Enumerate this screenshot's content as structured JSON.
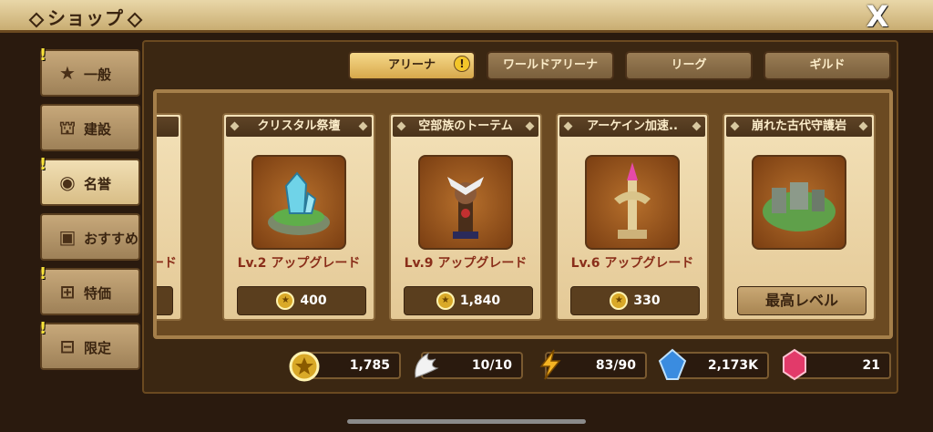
{
  "header": {
    "title": "ショップ",
    "close_label": "X"
  },
  "sidebar": {
    "items": [
      {
        "label": "一般",
        "icon": "star-icon",
        "alert": true
      },
      {
        "label": "建設",
        "icon": "building-icon",
        "alert": false
      },
      {
        "label": "名誉",
        "icon": "medal-icon",
        "alert": true,
        "active": true
      },
      {
        "label": "おすすめ",
        "icon": "gift-box-icon",
        "alert": false
      },
      {
        "label": "特価",
        "icon": "present-icon",
        "alert": true
      },
      {
        "label": "限定",
        "icon": "chest-icon",
        "alert": true
      }
    ],
    "alert_mark": "!"
  },
  "tabs": [
    {
      "label": "アリーナ",
      "active": true,
      "badge": "!"
    },
    {
      "label": "ワールドアリーナ",
      "active": false
    },
    {
      "label": "リーグ",
      "active": false
    },
    {
      "label": "ギルド",
      "active": false
    }
  ],
  "cards": [
    {
      "name": "",
      "upgrade": "レード",
      "price": "",
      "partial": true
    },
    {
      "name": "クリスタル祭壇",
      "upgrade": "Lv.2 アップグレード",
      "price": "400",
      "icon": "crystal-altar-icon"
    },
    {
      "name": "空部族のトーテム",
      "upgrade": "Lv.9 アップグレード",
      "price": "1,840",
      "icon": "totem-icon"
    },
    {
      "name": "アーケイン加速..",
      "upgrade": "Lv.6 アップグレード",
      "price": "330",
      "icon": "arcane-tower-icon"
    },
    {
      "name": "崩れた古代守護岩",
      "upgrade": "",
      "price": "最高レベル",
      "max": true,
      "icon": "ancient-rock-icon"
    }
  ],
  "resources": [
    {
      "icon": "honor-medal-icon",
      "value": "1,785"
    },
    {
      "icon": "wing-icon",
      "value": "10/10"
    },
    {
      "icon": "lightning-icon",
      "value": "83/90"
    },
    {
      "icon": "blue-crystal-icon",
      "value": "2,173K"
    },
    {
      "icon": "red-gem-icon",
      "value": "21"
    }
  ],
  "colors": {
    "accent": "#d7a84b",
    "price_text": "#8a2e1a",
    "panel": "#3b2712"
  }
}
